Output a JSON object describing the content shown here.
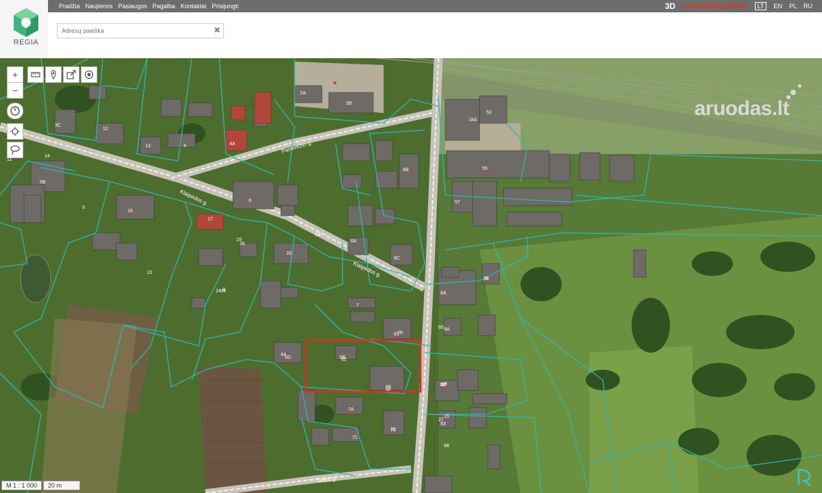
{
  "nav": [
    "Pradžia",
    "Naujienos",
    "Paslaugos",
    "Pagalba",
    "Kontaktai",
    "Prisijungti"
  ],
  "right_nav": {
    "d3": "3D",
    "municipality": "Savivaldybių REGIA",
    "languages": [
      "LT",
      "EN",
      "PL",
      "RU"
    ],
    "active_language": "LT"
  },
  "logo": {
    "text": "REGIA"
  },
  "search": {
    "placeholder": "Adresų paieška",
    "value": ""
  },
  "watermark": "aruodas.lt",
  "scale": {
    "ratio": "M 1 : 1 000",
    "bar": "20 m"
  },
  "streets": [
    "Panevėžio g.",
    "Klaipėdos g.",
    "Klaipėdos g.",
    "Liepų g."
  ],
  "house_numbers": [
    "2A",
    "2B",
    "3C",
    "4",
    "4A",
    "5",
    "5A",
    "5B",
    "6",
    "6A",
    "6B",
    "6C",
    "6D",
    "6E",
    "6F",
    "7",
    "7A",
    "8",
    "8A",
    "9",
    "9A",
    "10",
    "11",
    "12",
    "13",
    "14",
    "15",
    "16",
    "17",
    "18",
    "18A",
    "19",
    "20",
    "21",
    "24",
    "26",
    "27",
    "34",
    "35",
    "52",
    "55",
    "57",
    "59",
    "60",
    "61",
    "62",
    "63",
    "64",
    "65",
    "66",
    "67",
    "68",
    "70",
    "71"
  ],
  "colors": {
    "topbar": "#6d6d6d",
    "parcel_line": "#2fb5b0",
    "highlight": "#e52b1f",
    "logo_green": "#3eb57a"
  }
}
